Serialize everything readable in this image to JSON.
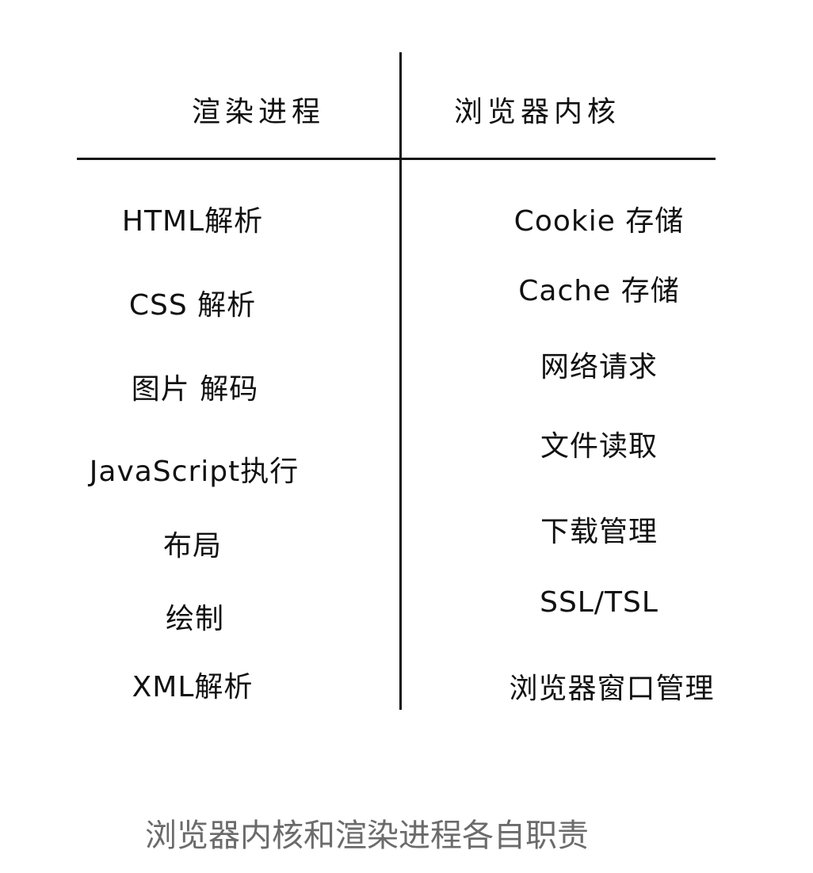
{
  "headers": {
    "left": "渲染进程",
    "right": "浏览器内核"
  },
  "left_items": [
    "HTML解析",
    "CSS 解析",
    "图片 解码",
    "JavaScript执行",
    "布局",
    "绘制",
    "XML解析"
  ],
  "right_items": [
    "Cookie 存储",
    "Cache 存储",
    "网络请求",
    "文件读取",
    "下载管理",
    "SSL/TSL",
    "浏览器窗口管理"
  ],
  "caption": "浏览器内核和渲染进程各自职责"
}
